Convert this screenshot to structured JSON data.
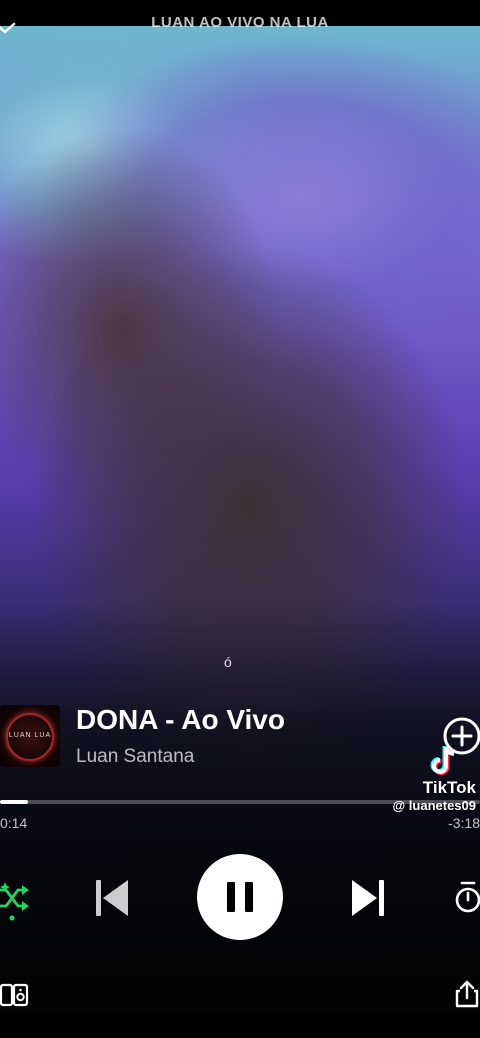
{
  "header": {
    "playlist_title": "LUAN AO VIVO NA LUA"
  },
  "video": {
    "caption": "ó"
  },
  "track": {
    "cover_text": "LUAN LUA",
    "title": "DONA - Ao Vivo",
    "artist": "Luan Santana"
  },
  "progress": {
    "elapsed": "0:14",
    "remaining": "-3:18",
    "fraction": 0.058
  },
  "watermark": {
    "brand": "TikTok",
    "username": "@ luanetes09"
  },
  "icons": {
    "collapse": "chevron-down-icon",
    "add": "add-circle-icon",
    "shuffle": "smart-shuffle-icon",
    "previous": "skip-previous-icon",
    "pause": "pause-icon",
    "next": "skip-next-icon",
    "timer": "sleep-timer-icon",
    "devices": "connect-devices-icon",
    "share": "share-icon",
    "tiktok": "tiktok-logo-icon"
  },
  "colors": {
    "accent": "#1ed760",
    "background": "#000000"
  }
}
